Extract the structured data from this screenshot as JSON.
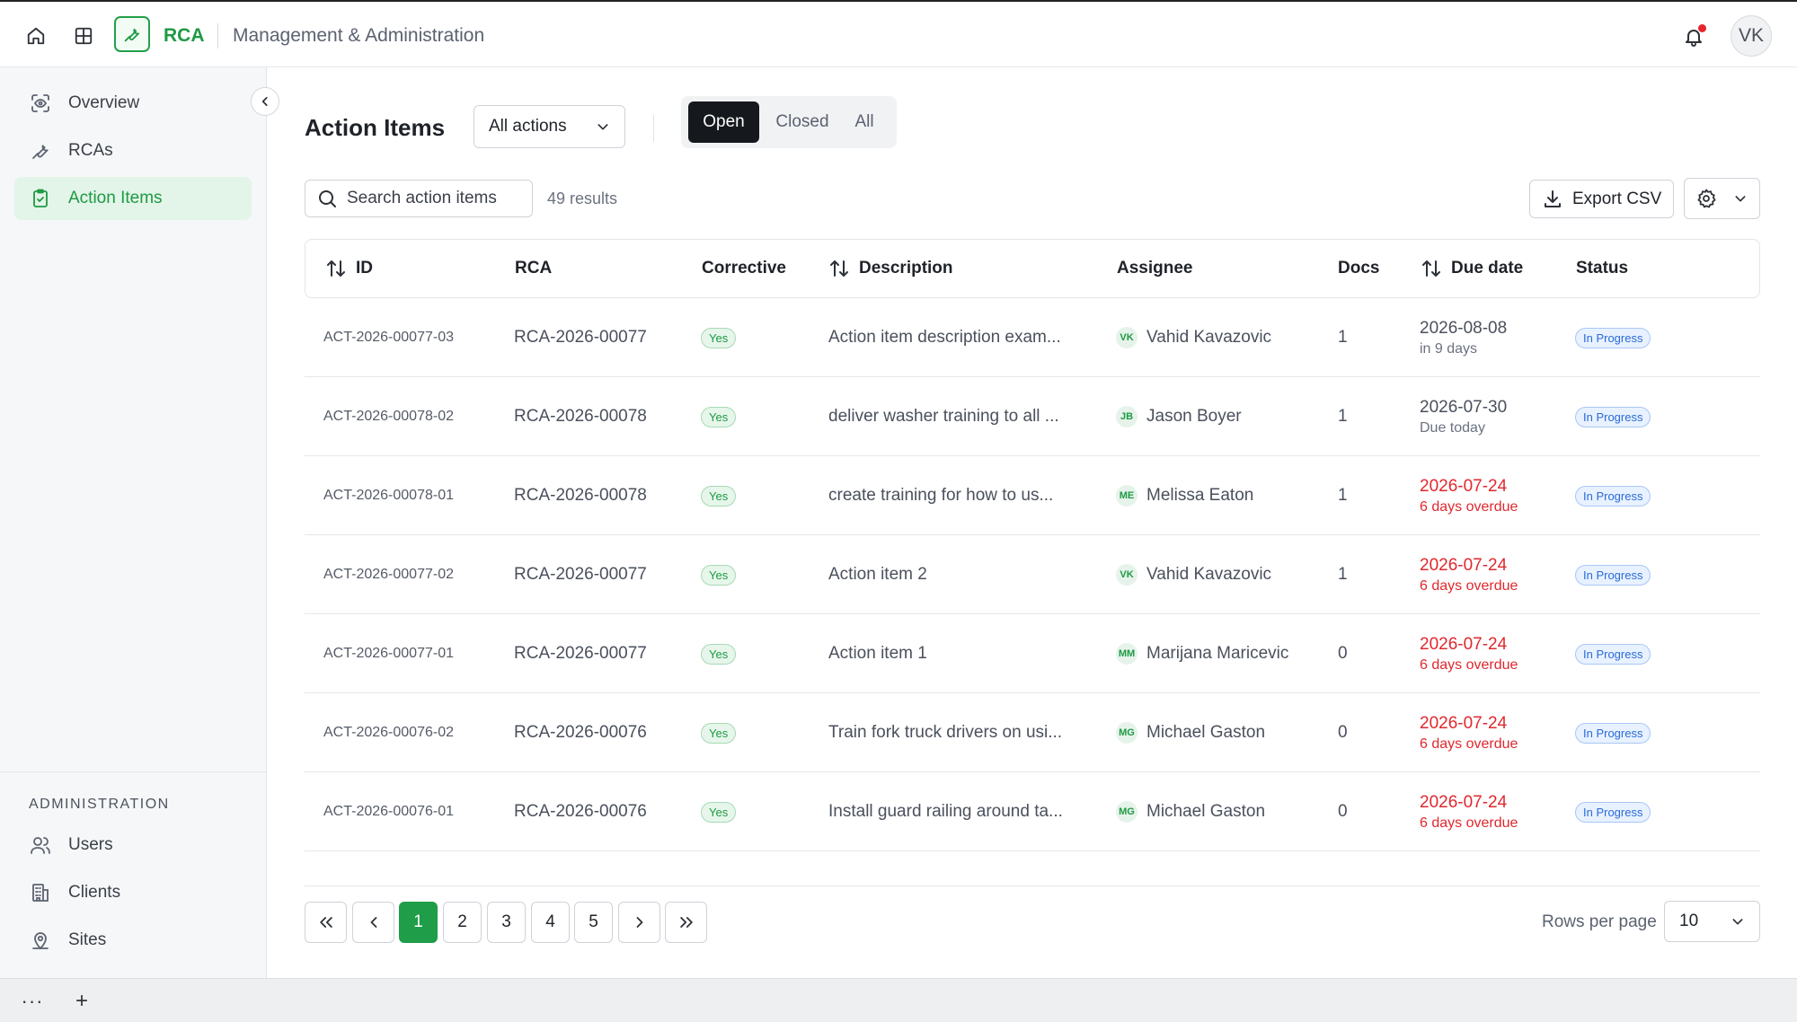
{
  "header": {
    "app_name": "RCA",
    "subtitle": "Management & Administration",
    "user_initials": "VK",
    "accent": "#1e9a44"
  },
  "sidebar": {
    "items": [
      {
        "label": "Overview",
        "icon": "eye-scan-icon"
      },
      {
        "label": "RCAs",
        "icon": "wrench-icon"
      },
      {
        "label": "Action Items",
        "icon": "clipboard-check-icon",
        "active": true
      }
    ],
    "admin_title": "ADMINISTRATION",
    "admin_items": [
      {
        "label": "Users",
        "icon": "users-icon"
      },
      {
        "label": "Clients",
        "icon": "building-icon"
      },
      {
        "label": "Sites",
        "icon": "map-pin-icon"
      }
    ]
  },
  "page": {
    "title": "Action Items",
    "filter_select": "All actions",
    "segments": [
      "Open",
      "Closed",
      "All"
    ],
    "active_segment": "Open",
    "search_placeholder": "Search action items",
    "results": "49 results",
    "export_label": "Export CSV"
  },
  "table": {
    "columns": [
      "ID",
      "RCA",
      "Corrective",
      "Description",
      "Assignee",
      "Docs",
      "Due date",
      "Status"
    ],
    "rows": [
      {
        "id": "ACT-2026-00077-03",
        "rca": "RCA-2026-00077",
        "corrective": "Yes",
        "description": "Action item description exam...",
        "initials": "VK",
        "assignee": "Vahid Kavazovic",
        "docs": "1",
        "due": "2026-08-08",
        "due_note": "in 9 days",
        "overdue": false,
        "status": "In Progress"
      },
      {
        "id": "ACT-2026-00078-02",
        "rca": "RCA-2026-00078",
        "corrective": "Yes",
        "description": "deliver washer training to all ...",
        "initials": "JB",
        "assignee": "Jason Boyer",
        "docs": "1",
        "due": "2026-07-30",
        "due_note": "Due today",
        "overdue": false,
        "status": "In Progress"
      },
      {
        "id": "ACT-2026-00078-01",
        "rca": "RCA-2026-00078",
        "corrective": "Yes",
        "description": "create training for how to us...",
        "initials": "ME",
        "assignee": "Melissa Eaton",
        "docs": "1",
        "due": "2026-07-24",
        "due_note": "6 days overdue",
        "overdue": true,
        "status": "In Progress"
      },
      {
        "id": "ACT-2026-00077-02",
        "rca": "RCA-2026-00077",
        "corrective": "Yes",
        "description": "Action item 2",
        "initials": "VK",
        "assignee": "Vahid Kavazovic",
        "docs": "1",
        "due": "2026-07-24",
        "due_note": "6 days overdue",
        "overdue": true,
        "status": "In Progress"
      },
      {
        "id": "ACT-2026-00077-01",
        "rca": "RCA-2026-00077",
        "corrective": "Yes",
        "description": "Action item 1",
        "initials": "MM",
        "assignee": "Marijana Maricevic",
        "docs": "0",
        "due": "2026-07-24",
        "due_note": "6 days overdue",
        "overdue": true,
        "status": "In Progress"
      },
      {
        "id": "ACT-2026-00076-02",
        "rca": "RCA-2026-00076",
        "corrective": "Yes",
        "description": "Train fork truck drivers on usi...",
        "initials": "MG",
        "assignee": "Michael Gaston",
        "docs": "0",
        "due": "2026-07-24",
        "due_note": "6 days overdue",
        "overdue": true,
        "status": "In Progress"
      },
      {
        "id": "ACT-2026-00076-01",
        "rca": "RCA-2026-00076",
        "corrective": "Yes",
        "description": "Install guard railing around ta...",
        "initials": "MG",
        "assignee": "Michael Gaston",
        "docs": "0",
        "due": "2026-07-24",
        "due_note": "6 days overdue",
        "overdue": true,
        "status": "In Progress"
      }
    ]
  },
  "pagination": {
    "pages": [
      "1",
      "2",
      "3",
      "4",
      "5"
    ],
    "current": "1",
    "rows_label": "Rows per page",
    "rows_value": "10"
  },
  "bottom_bar": {
    "more": "···",
    "add": "+"
  }
}
